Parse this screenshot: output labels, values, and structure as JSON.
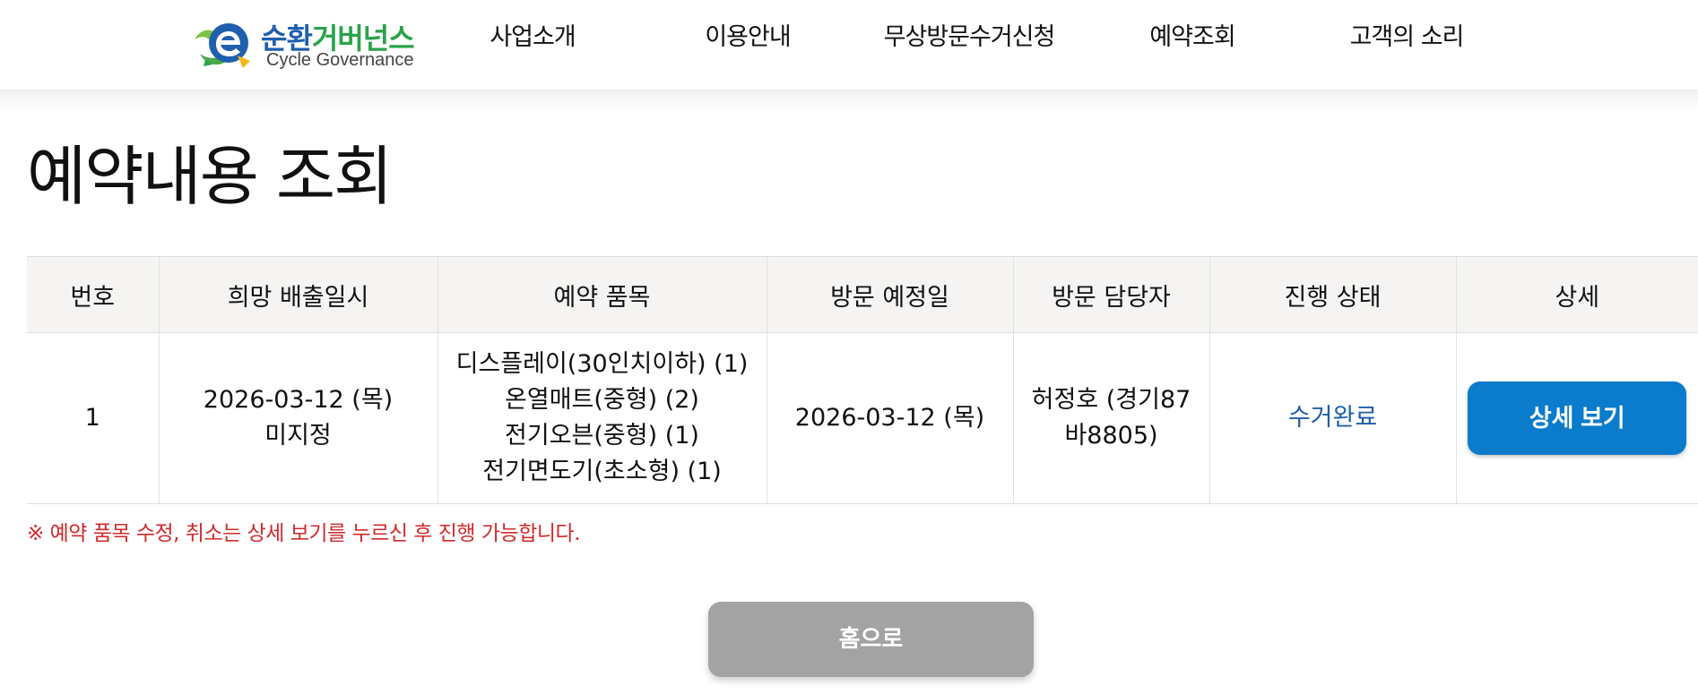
{
  "brand": {
    "name_part1": "순환",
    "name_part2": "거버넌스",
    "subtitle": "Cycle Governance",
    "colors": {
      "blue": "#1f5fae",
      "green": "#2aa34a"
    }
  },
  "nav": {
    "items": [
      {
        "label": "사업소개"
      },
      {
        "label": "이용안내"
      },
      {
        "label": "무상방문수거신청"
      },
      {
        "label": "예약조회"
      },
      {
        "label": "고객의 소리"
      }
    ]
  },
  "page_title": "예약내용 조회",
  "table": {
    "headers": [
      "번호",
      "희망 배출일시",
      "예약 품목",
      "방문 예정일",
      "방문 담당자",
      "진행 상태",
      "상세"
    ],
    "rows": [
      {
        "number": "1",
        "desired_date": "2026-03-12 (목)",
        "desired_time": "미지정",
        "items": [
          "디스플레이(30인치이하) (1)",
          "온열매트(중형) (2)",
          "전기오븐(중형) (1)",
          "전기면도기(초소형) (1)"
        ],
        "visit_date": "2026-03-12 (목)",
        "staff_line1": "허정호 (경기87",
        "staff_line2": "바8805)",
        "status": "수거완료",
        "detail_label": "상세 보기"
      }
    ]
  },
  "notice": "※ 예약 품목 수정, 취소는 상세 보기를 누르신 후 진행 가능합니다.",
  "home_button": "홈으로",
  "colors": {
    "status_text": "#1d5fa8",
    "detail_button": "#0a7ccb",
    "notice_text": "#d12a2a",
    "home_button": "#a3a3a3",
    "table_header_bg": "#f5f4f2"
  }
}
